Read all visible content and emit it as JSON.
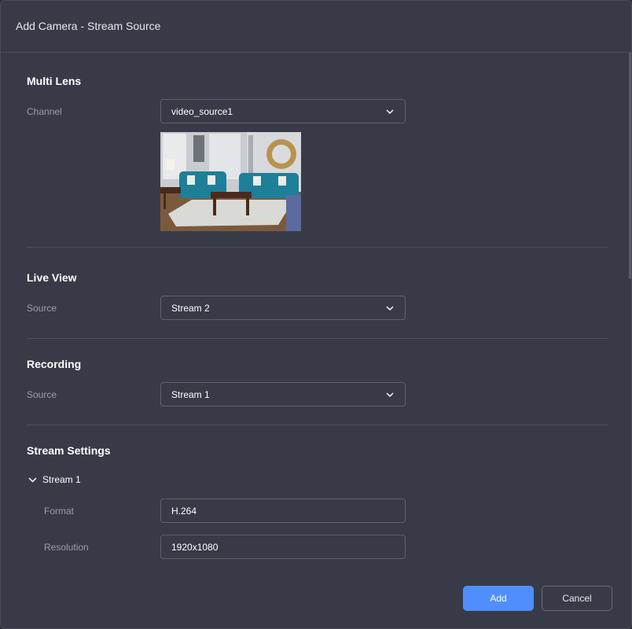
{
  "dialog": {
    "title": "Add Camera - Stream Source"
  },
  "multi_lens": {
    "title": "Multi Lens",
    "channel_label": "Channel",
    "channel_value": "video_source1"
  },
  "live_view": {
    "title": "Live View",
    "source_label": "Source",
    "source_value": "Stream 2"
  },
  "recording": {
    "title": "Recording",
    "source_label": "Source",
    "source_value": "Stream 1"
  },
  "stream_settings": {
    "title": "Stream Settings",
    "stream_name": "Stream 1",
    "format_label": "Format",
    "format_value": "H.264",
    "resolution_label": "Resolution",
    "resolution_value": "1920x1080"
  },
  "buttons": {
    "add": "Add",
    "cancel": "Cancel"
  },
  "colors": {
    "background": "#383b47",
    "accent": "#4f8efc",
    "text": "#ffffff",
    "label": "#9a9dab"
  },
  "icons": {
    "dropdown": "chevron-down-icon",
    "collapse": "chevron-down-icon"
  }
}
